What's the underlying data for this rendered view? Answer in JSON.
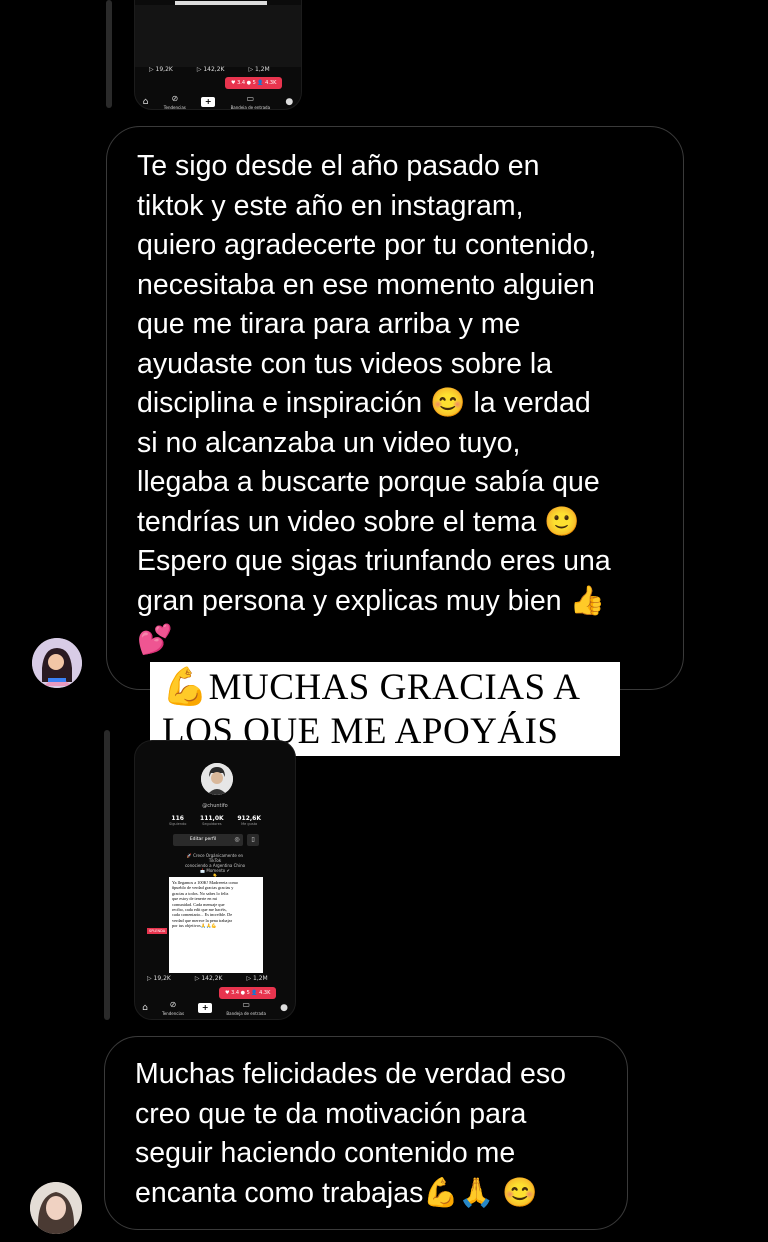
{
  "story_top": {
    "stats": [
      "19,2K",
      "142,2K",
      "1,2M"
    ],
    "notif": "♥ 3.4  ● 5  👤 4.3K",
    "nav": {
      "plus": "+",
      "item_a": "Tendencias",
      "item_b": "Bandeja de entrada"
    }
  },
  "message_1": {
    "text": "Te sigo desde el año pasado en\ntiktok y este año en instagram,\nquiero agradecerte por tu contenido,\nnecesitaba en ese momento alguien\nque me tirara para arriba y me\nayudaste con tus videos sobre la\ndisciplina e inspiración 😊 la verdad\nsi no alcanzaba un video tuyo,\nllegaba a buscarte porque sabía que\ntendrías un video sobre el tema 🙂\nEspero que sigas triunfando eres una\ngran persona y explicas muy bien 👍\n💕"
  },
  "caption": {
    "line1": "💪MUCHAS GRACIAS A",
    "line2": "LOS QUE ME APOYÁIS"
  },
  "story_bottom": {
    "handle": "@chuntifo",
    "stats": [
      {
        "value": "116",
        "label": "Siguiendo"
      },
      {
        "value": "111,0K",
        "label": "Seguidores"
      },
      {
        "value": "912,6K",
        "label": "Me gusta"
      }
    ],
    "edit_label": "Editar perfil",
    "bio": "🚀 Crece Orgánicamente en TikTok\nconociendo a Argentina Chino\n📩 Momento ✔\n👇",
    "note": "Ya llegamos a 100K! Madreeeia como\n#pueblo de verdad gracias gracias y\ngracias a todos. No sabes lo feliz\nque estoy de tenerte en mi\ncomunidad. Cada mensaje que\nrecibo, cada edit que me hacéis,\ncada comentario... Es increíble. De\nverdad que merece la pena trabajar\npor tus objetivos🙏🙏💪",
    "tag": "SPLENDA",
    "thumb_stats": [
      "19,2K",
      "142,2K",
      "1,2M"
    ],
    "notif": "♥ 3.4  ● 5  👤 4.3K",
    "nav": {
      "plus": "+",
      "item_a": "Tendencias",
      "item_b": "Bandeja de entrada"
    }
  },
  "message_2": {
    "text": "Muchas felicidades de verdad eso\ncreo que te da motivación para\nseguir haciendo contenido me\nencanta como trabajas💪🙏 😊"
  },
  "icons": {
    "home": "home-icon",
    "compass": "compass-icon",
    "inbox": "inbox-icon",
    "profile": "profile-icon"
  }
}
